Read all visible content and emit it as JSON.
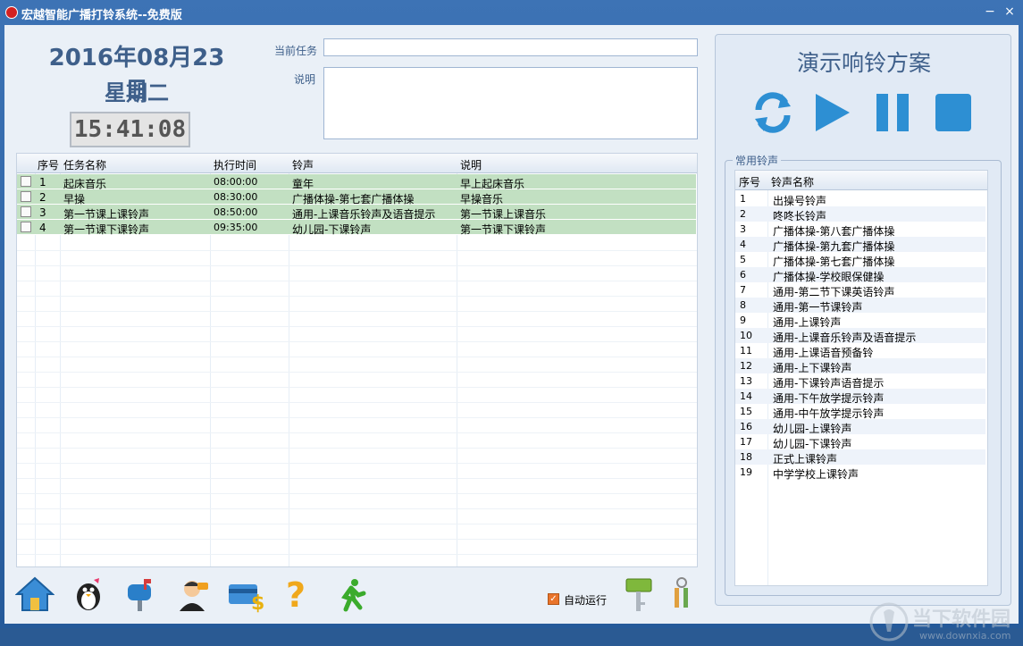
{
  "window": {
    "title": "宏越智能广播打铃系统--免费版",
    "min_glyph": "−",
    "close_glyph": "×"
  },
  "clock": {
    "date": "2016年08月23日",
    "weekday": "星期二",
    "time": "15:41:08"
  },
  "task": {
    "current_label": "当前任务",
    "current_value": "",
    "desc_label": "说明",
    "desc_value": ""
  },
  "tasks": {
    "columns": [
      "序号",
      "任务名称",
      "执行时间",
      "铃声",
      "说明"
    ],
    "rows": [
      {
        "no": "1",
        "name": "起床音乐",
        "time": "08:00:00",
        "ring": "童年",
        "desc": "早上起床音乐"
      },
      {
        "no": "2",
        "name": "早操",
        "time": "08:30:00",
        "ring": "广播体操-第七套广播体操",
        "desc": "早操音乐"
      },
      {
        "no": "3",
        "name": "第一节课上课铃声",
        "time": "08:50:00",
        "ring": "通用-上课音乐铃声及语音提示",
        "desc": "第一节课上课音乐"
      },
      {
        "no": "4",
        "name": "第一节课下课铃声",
        "time": "09:35:00",
        "ring": "幼儿园-下课铃声",
        "desc": "第一节课下课铃声"
      }
    ]
  },
  "toolbar": {
    "icons": [
      "home-icon",
      "qq-penguin-icon",
      "mailbox-icon",
      "support-agent-icon",
      "payment-card-icon",
      "help-icon",
      "exit-runner-icon"
    ],
    "auto_run_label": "自动运行",
    "auto_run_checked": true,
    "right_icons": [
      "register-key-icon",
      "keys-icon"
    ]
  },
  "demo": {
    "title": "演示响铃方案",
    "buttons": [
      "refresh-icon",
      "play-icon",
      "pause-icon",
      "stop-icon"
    ],
    "accent": "#2d8fd3"
  },
  "rings": {
    "legend": "常用铃声",
    "columns": [
      "序号",
      "铃声名称"
    ],
    "rows": [
      {
        "no": "1",
        "name": "出操号铃声"
      },
      {
        "no": "2",
        "name": "咚咚长铃声"
      },
      {
        "no": "3",
        "name": "广播体操-第八套广播体操"
      },
      {
        "no": "4",
        "name": "广播体操-第九套广播体操"
      },
      {
        "no": "5",
        "name": "广播体操-第七套广播体操"
      },
      {
        "no": "6",
        "name": "广播体操-学校眼保健操"
      },
      {
        "no": "7",
        "name": "通用-第二节下课英语铃声"
      },
      {
        "no": "8",
        "name": "通用-第一节课铃声"
      },
      {
        "no": "9",
        "name": "通用-上课铃声"
      },
      {
        "no": "10",
        "name": "通用-上课音乐铃声及语音提示"
      },
      {
        "no": "11",
        "name": "通用-上课语音预备铃"
      },
      {
        "no": "12",
        "name": "通用-上下课铃声"
      },
      {
        "no": "13",
        "name": "通用-下课铃声语音提示"
      },
      {
        "no": "14",
        "name": "通用-下午放学提示铃声"
      },
      {
        "no": "15",
        "name": "通用-中午放学提示铃声"
      },
      {
        "no": "16",
        "name": "幼儿园-上课铃声"
      },
      {
        "no": "17",
        "name": "幼儿园-下课铃声"
      },
      {
        "no": "18",
        "name": "正式上课铃声"
      },
      {
        "no": "19",
        "name": "中学学校上课铃声"
      }
    ]
  },
  "watermark": {
    "brand": "当下软件园",
    "url": "www.downxia.com"
  }
}
